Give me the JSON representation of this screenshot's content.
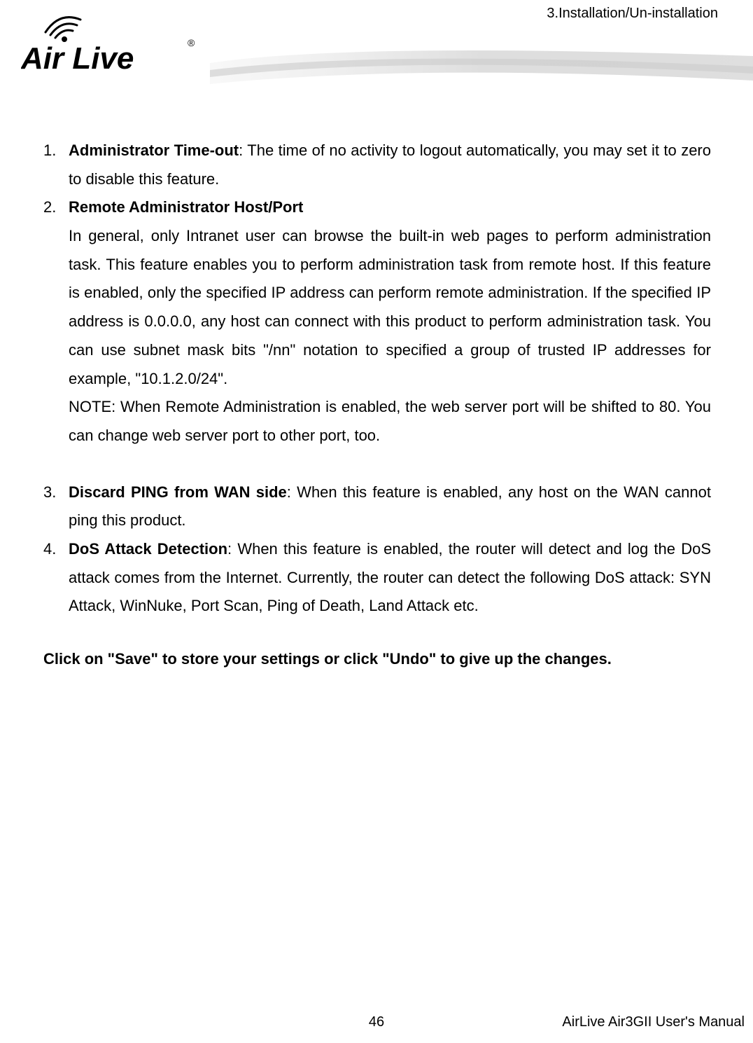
{
  "header": {
    "breadcrumb": "3.Installation/Un-installation",
    "logo_text": "Air Live",
    "logo_trademark": "®"
  },
  "items": {
    "1": {
      "num": "1.",
      "title": "Administrator Time-out",
      "body": ": The time of no activity to logout automatically, you may set it to zero to disable this feature."
    },
    "2": {
      "num": "2.",
      "title": "Remote Administrator Host/Port",
      "body1": "In general, only Intranet user can browse the built-in web pages to perform administration task. This feature enables you to perform administration task from remote host. If this feature is enabled, only the specified IP address can perform remote administration. If the specified IP address is 0.0.0.0, any host can connect with this product to perform administration task. You can use subnet mask bits \"/nn\" notation to specified a group of trusted IP addresses for example, \"10.1.2.0/24\".",
      "body2": "NOTE: When Remote Administration is enabled, the web server port will be shifted to 80. You can change web server port to other port, too."
    },
    "3": {
      "num": "3.",
      "title": "Discard PING from WAN side",
      "body": ": When this feature is enabled, any host on the WAN cannot ping this product."
    },
    "4": {
      "num": "4.",
      "title": "DoS Attack Detection",
      "body": ": When this feature is enabled, the router will detect and log the DoS attack comes from the Internet. Currently, the router can detect the following DoS attack: SYN Attack, WinNuke, Port Scan, Ping of Death, Land Attack etc."
    }
  },
  "note": "Click on \"Save\" to store your settings or click \"Undo\" to give up the changes.",
  "footer": {
    "page": "46",
    "right": "AirLive Air3GII User's Manual"
  }
}
